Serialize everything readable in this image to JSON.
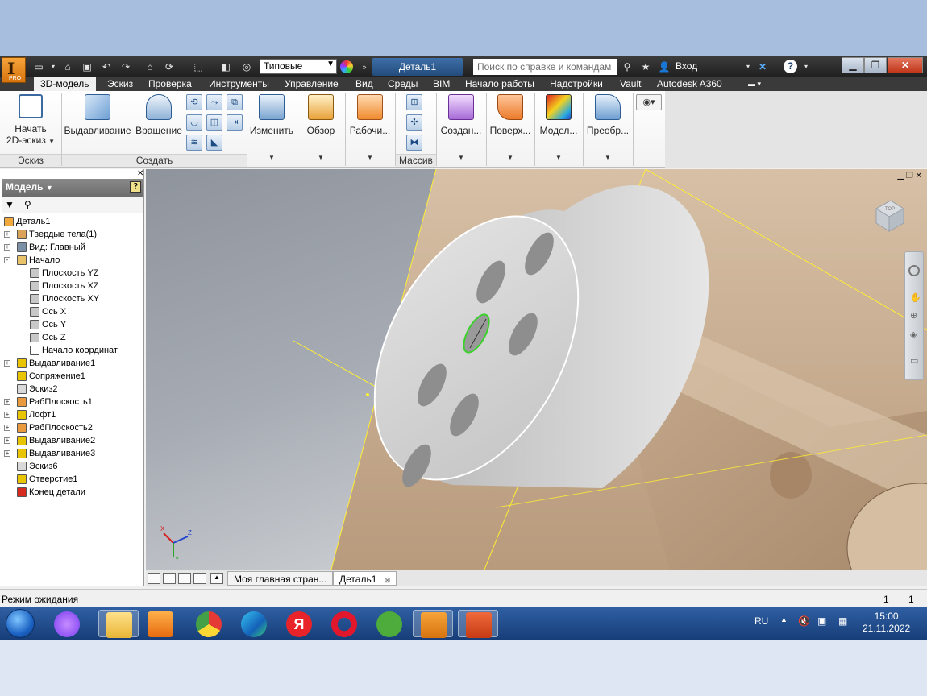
{
  "window": {
    "app_logo_letter": "I",
    "app_logo_sub": "PRO",
    "style_select": "Типовые",
    "document_title": "Деталь1",
    "search_placeholder": "Поиск по справке и командам",
    "login": "Вход",
    "help": "?"
  },
  "menu_tabs": [
    "3D-модель",
    "Эскиз",
    "Проверка",
    "Инструменты",
    "Управление",
    "Вид",
    "Среды",
    "BIM",
    "Начало работы",
    "Надстройки",
    "Vault",
    "Autodesk A360"
  ],
  "ribbon": {
    "sketch_start_line1": "Начать",
    "sketch_start_line2": "2D-эскиз",
    "extrude": "Выдавливание",
    "revolve": "Вращение",
    "modify": "Изменить",
    "explore": "Обзор",
    "work": "Рабочи...",
    "create_freeform": "Создан...",
    "surface": "Поверх...",
    "simulation": "Модел...",
    "convert": "Преобр...",
    "group_sketch": "Эскиз",
    "group_create": "Создать",
    "group_pattern": "Массив"
  },
  "browser": {
    "title": "Модель",
    "help": "?",
    "tree": [
      {
        "label": "Деталь1",
        "indent": 0,
        "expander": "",
        "icon": "part-icon",
        "color": "#f2a93b"
      },
      {
        "label": "Твердые тела(1)",
        "indent": 1,
        "expander": "+",
        "icon": "solid-bodies-icon",
        "color": "#d9a45a"
      },
      {
        "label": "Вид: Главный",
        "indent": 1,
        "expander": "+",
        "icon": "view-icon",
        "color": "#7b8fa6"
      },
      {
        "label": "Начало",
        "indent": 1,
        "expander": "-",
        "icon": "origin-folder-icon",
        "color": "#e8c36a"
      },
      {
        "label": "Плоскость YZ",
        "indent": 2,
        "expander": "",
        "icon": "plane-icon",
        "color": "#c8c8c8"
      },
      {
        "label": "Плоскость XZ",
        "indent": 2,
        "expander": "",
        "icon": "plane-icon",
        "color": "#c8c8c8"
      },
      {
        "label": "Плоскость XY",
        "indent": 2,
        "expander": "",
        "icon": "plane-icon",
        "color": "#c8c8c8"
      },
      {
        "label": "Ось X",
        "indent": 2,
        "expander": "",
        "icon": "axis-icon",
        "color": "#c8c8c8"
      },
      {
        "label": "Ось Y",
        "indent": 2,
        "expander": "",
        "icon": "axis-icon",
        "color": "#c8c8c8"
      },
      {
        "label": "Ось Z",
        "indent": 2,
        "expander": "",
        "icon": "axis-icon",
        "color": "#c8c8c8"
      },
      {
        "label": "Начало координат",
        "indent": 2,
        "expander": "",
        "icon": "center-point-icon",
        "color": "#ffffff"
      },
      {
        "label": "Выдавливание1",
        "indent": 1,
        "expander": "+",
        "icon": "extrude-feature-icon",
        "color": "#e9c400"
      },
      {
        "label": "Сопряжение1",
        "indent": 1,
        "expander": "",
        "icon": "fillet-icon",
        "color": "#e9c400"
      },
      {
        "label": "Эскиз2",
        "indent": 1,
        "expander": "",
        "icon": "sketch-icon",
        "color": "#d9d9d9"
      },
      {
        "label": "РабПлоскость1",
        "indent": 1,
        "expander": "+",
        "icon": "work-plane-icon",
        "color": "#e89a3c"
      },
      {
        "label": "Лофт1",
        "indent": 1,
        "expander": "+",
        "icon": "loft-icon",
        "color": "#e9c400"
      },
      {
        "label": "РабПлоскость2",
        "indent": 1,
        "expander": "+",
        "icon": "work-plane-icon",
        "color": "#e89a3c"
      },
      {
        "label": "Выдавливание2",
        "indent": 1,
        "expander": "+",
        "icon": "extrude-feature-icon",
        "color": "#e9c400"
      },
      {
        "label": "Выдавливание3",
        "indent": 1,
        "expander": "+",
        "icon": "extrude-feature-icon",
        "color": "#e9c400"
      },
      {
        "label": "Эскиз6",
        "indent": 1,
        "expander": "",
        "icon": "sketch-icon",
        "color": "#d9d9d9"
      },
      {
        "label": "Отверстие1",
        "indent": 1,
        "expander": "",
        "icon": "hole-icon",
        "color": "#e9c400"
      },
      {
        "label": "Конец детали",
        "indent": 1,
        "expander": "",
        "icon": "end-of-part-icon",
        "color": "#d62a1e"
      }
    ]
  },
  "viewport": {
    "viewcube_label": "TOP",
    "triad": {
      "x": "X",
      "y": "Y",
      "z": "Z"
    }
  },
  "doc_tabs": {
    "home": "Моя главная стран...",
    "part": "Деталь1"
  },
  "status": {
    "message": "Режим ожидания",
    "count1": "1",
    "count2": "1"
  },
  "taskbar": {
    "language": "RU",
    "time": "15:00",
    "date": "21.11.2022",
    "yandex_letter": "Я"
  }
}
